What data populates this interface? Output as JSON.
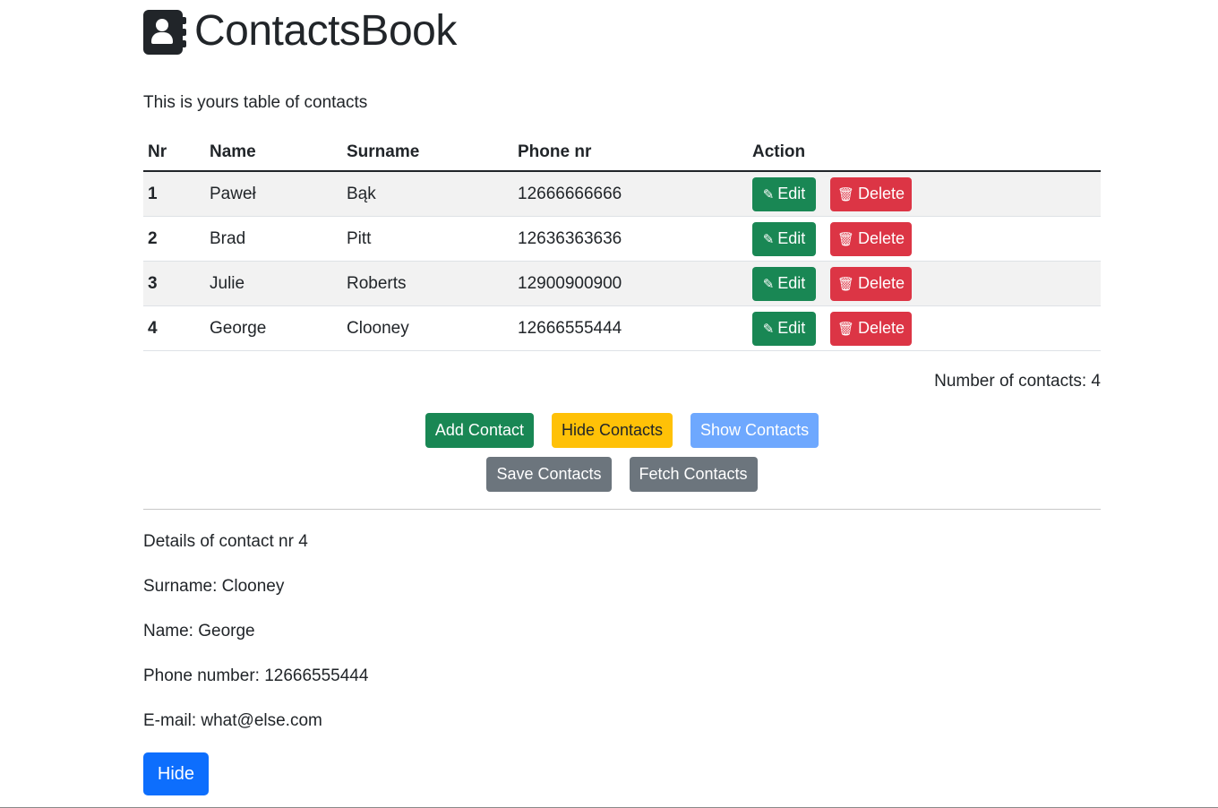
{
  "header": {
    "title": "ContactsBook",
    "logo_icon": "address-book-icon"
  },
  "intro": "This is yours table of contacts",
  "table": {
    "headers": [
      "Nr",
      "Name",
      "Surname",
      "Phone nr",
      "Action"
    ],
    "rows": [
      {
        "nr": "1",
        "name": "Paweł",
        "surname": "Bąk",
        "phone": "12666666666"
      },
      {
        "nr": "2",
        "name": "Brad",
        "surname": "Pitt",
        "phone": "12636363636"
      },
      {
        "nr": "3",
        "name": "Julie",
        "surname": "Roberts",
        "phone": "12900900900"
      },
      {
        "nr": "4",
        "name": "George",
        "surname": "Clooney",
        "phone": "12666555444"
      }
    ],
    "edit_label": "Edit",
    "delete_label": "Delete"
  },
  "count_text": "Number of contacts: 4",
  "actions": {
    "add": "Add Contact",
    "hide": "Hide Contacts",
    "show": "Show Contacts",
    "save": "Save Contacts",
    "fetch": "Fetch Contacts"
  },
  "details": {
    "heading": "Details of contact nr 4",
    "surname": "Surname: Clooney",
    "name": "Name: George",
    "phone": "Phone number: 12666555444",
    "email": "E-mail: what@else.com",
    "hide_label": "Hide"
  },
  "colors": {
    "success": "#198754",
    "danger": "#dc3545",
    "warning": "#ffc107",
    "info_light": "#6ea8fe",
    "secondary": "#6c757d",
    "primary": "#0d6efd"
  }
}
